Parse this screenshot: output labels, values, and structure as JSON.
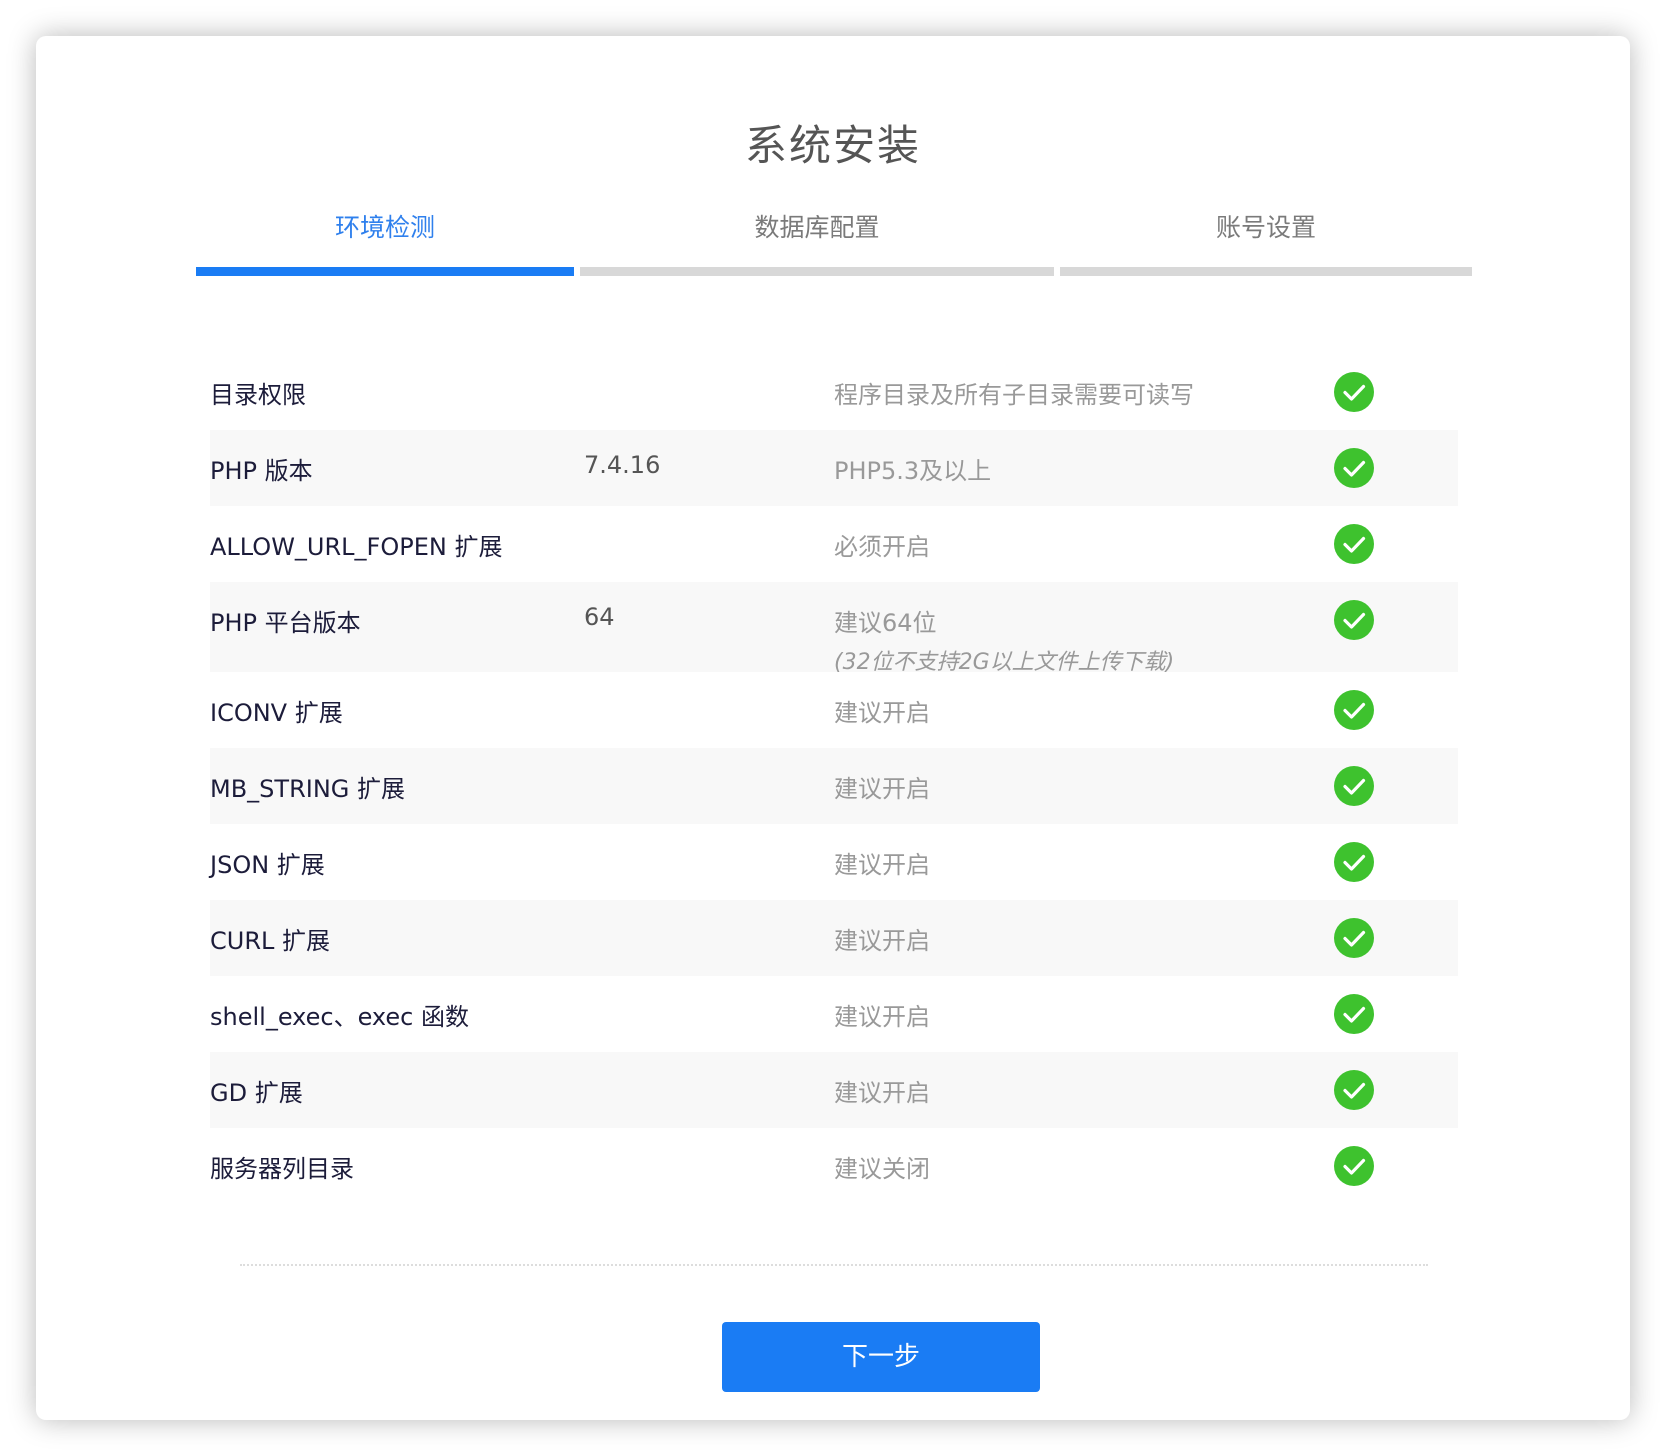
{
  "title": "系统安装",
  "steps": [
    {
      "label": "环境检测",
      "active": true
    },
    {
      "label": "数据库配置",
      "active": false
    },
    {
      "label": "账号设置",
      "active": false
    }
  ],
  "checks": [
    {
      "name": "目录权限",
      "current": "",
      "requirement": "程序目录及所有子目录需要可读写",
      "note": "",
      "status": "ok"
    },
    {
      "name": "PHP 版本",
      "current": "7.4.16",
      "requirement": "PHP5.3及以上",
      "note": "",
      "status": "ok"
    },
    {
      "name": "ALLOW_URL_FOPEN 扩展",
      "current": "",
      "requirement": "必须开启",
      "note": "",
      "status": "ok"
    },
    {
      "name": "PHP 平台版本",
      "current": "64",
      "requirement": "建议64位",
      "note": "(32位不支持2G以上文件上传下载)",
      "status": "ok"
    },
    {
      "name": "ICONV 扩展",
      "current": "",
      "requirement": "建议开启",
      "note": "",
      "status": "ok"
    },
    {
      "name": "MB_STRING 扩展",
      "current": "",
      "requirement": "建议开启",
      "note": "",
      "status": "ok"
    },
    {
      "name": "JSON 扩展",
      "current": "",
      "requirement": "建议开启",
      "note": "",
      "status": "ok"
    },
    {
      "name": "CURL 扩展",
      "current": "",
      "requirement": "建议开启",
      "note": "",
      "status": "ok"
    },
    {
      "name": "shell_exec、exec 函数",
      "current": "",
      "requirement": "建议开启",
      "note": "",
      "status": "ok"
    },
    {
      "name": "GD 扩展",
      "current": "",
      "requirement": "建议开启",
      "note": "",
      "status": "ok"
    },
    {
      "name": "服务器列目录",
      "current": "",
      "requirement": "建议关闭",
      "note": "",
      "status": "ok"
    }
  ],
  "next_button": "下一步",
  "colors": {
    "accent": "#1a7cf4",
    "check_ok": "#3ec22e",
    "inactive_bar": "#d8d8d8"
  }
}
